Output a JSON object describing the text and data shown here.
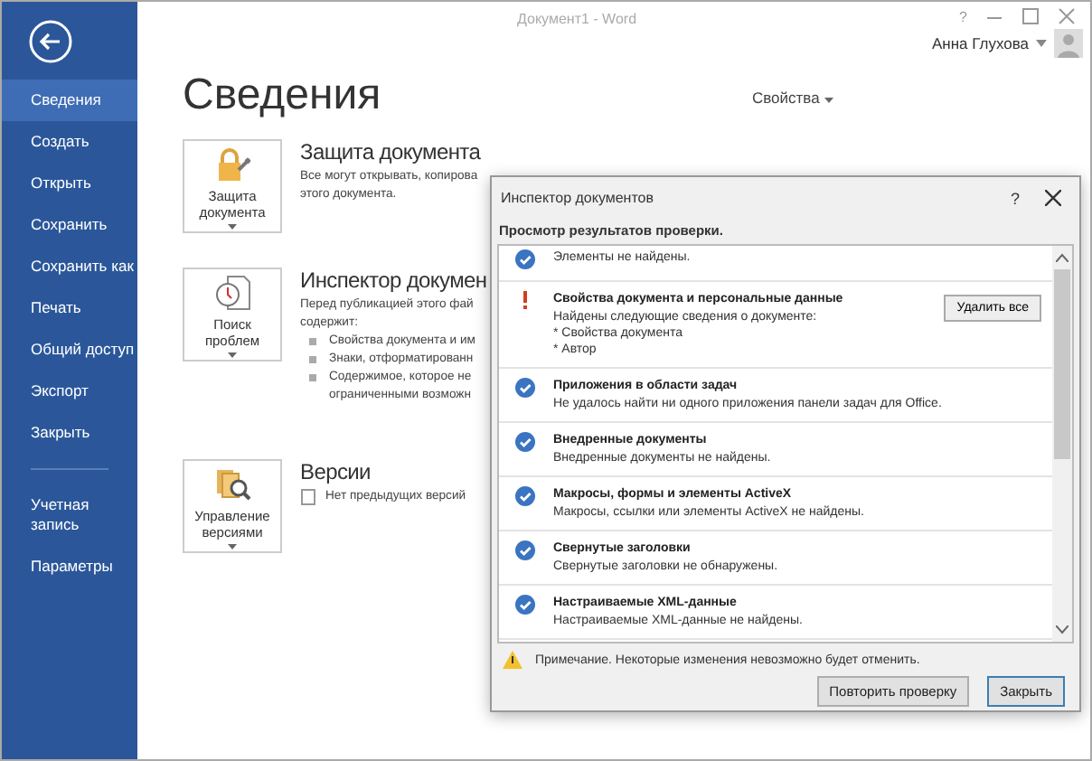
{
  "window": {
    "title": "Документ1 - Word",
    "help": "?",
    "user": "Анна Глухова"
  },
  "sidebar": {
    "items": [
      {
        "label": "Сведения",
        "selected": true
      },
      {
        "label": "Создать",
        "selected": false
      },
      {
        "label": "Открыть",
        "selected": false
      },
      {
        "label": "Сохранить",
        "selected": false
      },
      {
        "label": "Сохранить как",
        "selected": false
      },
      {
        "label": "Печать",
        "selected": false
      },
      {
        "label": "Общий доступ",
        "selected": false
      },
      {
        "label": "Экспорт",
        "selected": false
      },
      {
        "label": "Закрыть",
        "selected": false
      }
    ],
    "bottom_items": [
      {
        "label": "Учетная запись",
        "selected": false
      },
      {
        "label": "Параметры",
        "selected": false
      }
    ]
  },
  "page": {
    "title": "Сведения",
    "properties": "Свойства",
    "sections": [
      {
        "kind": "protect",
        "button": "Защита документа",
        "heading": "Защита документа",
        "lines": [
          "Все могут открывать, копирова",
          "этого документа."
        ]
      },
      {
        "kind": "inspect",
        "button": "Поиск проблем",
        "heading": "Инспектор докумен",
        "lines": [
          "Перед публикацией этого фай",
          "содержит:"
        ],
        "bullets": [
          "Свойства документа и им",
          "Знаки, отформатированн",
          "Содержимое, которое не",
          "ограниченными возможн"
        ]
      },
      {
        "kind": "versions",
        "button": "Управление версиями",
        "heading": "Версии",
        "lines": [
          "Нет предыдущих версий"
        ]
      }
    ]
  },
  "dialog": {
    "title": "Инспектор документов",
    "help": "?",
    "subtitle": "Просмотр результатов проверки.",
    "results": [
      {
        "kind": "ok",
        "lines": [
          "Элементы не найдены."
        ]
      },
      {
        "kind": "warning",
        "title": "Свойства документа и персональные данные",
        "lines": [
          "Найдены следующие сведения о документе:",
          "* Свойства документа",
          "* Автор"
        ],
        "button": "Удалить все"
      },
      {
        "kind": "ok",
        "title": "Приложения в области задач",
        "lines": [
          "Не удалось найти ни одного  приложения панели задач для Office."
        ]
      },
      {
        "kind": "ok",
        "title": "Внедренные документы",
        "lines": [
          "Внедренные документы не найдены."
        ]
      },
      {
        "kind": "ok",
        "title": "Макросы, формы и элементы ActiveX",
        "lines": [
          "Макросы, ссылки или элементы ActiveX не найдены."
        ]
      },
      {
        "kind": "ok",
        "title": "Свернутые заголовки",
        "lines": [
          "Свернутые заголовки не обнаружены."
        ]
      },
      {
        "kind": "ok",
        "title": "Настраиваемые XML-данные",
        "lines": [
          "Настраиваемые XML-данные не найдены."
        ]
      }
    ],
    "note": "Примечание. Некоторые изменения невозможно будет отменить.",
    "buttons": [
      "Повторить проверку",
      "Закрыть"
    ]
  }
}
